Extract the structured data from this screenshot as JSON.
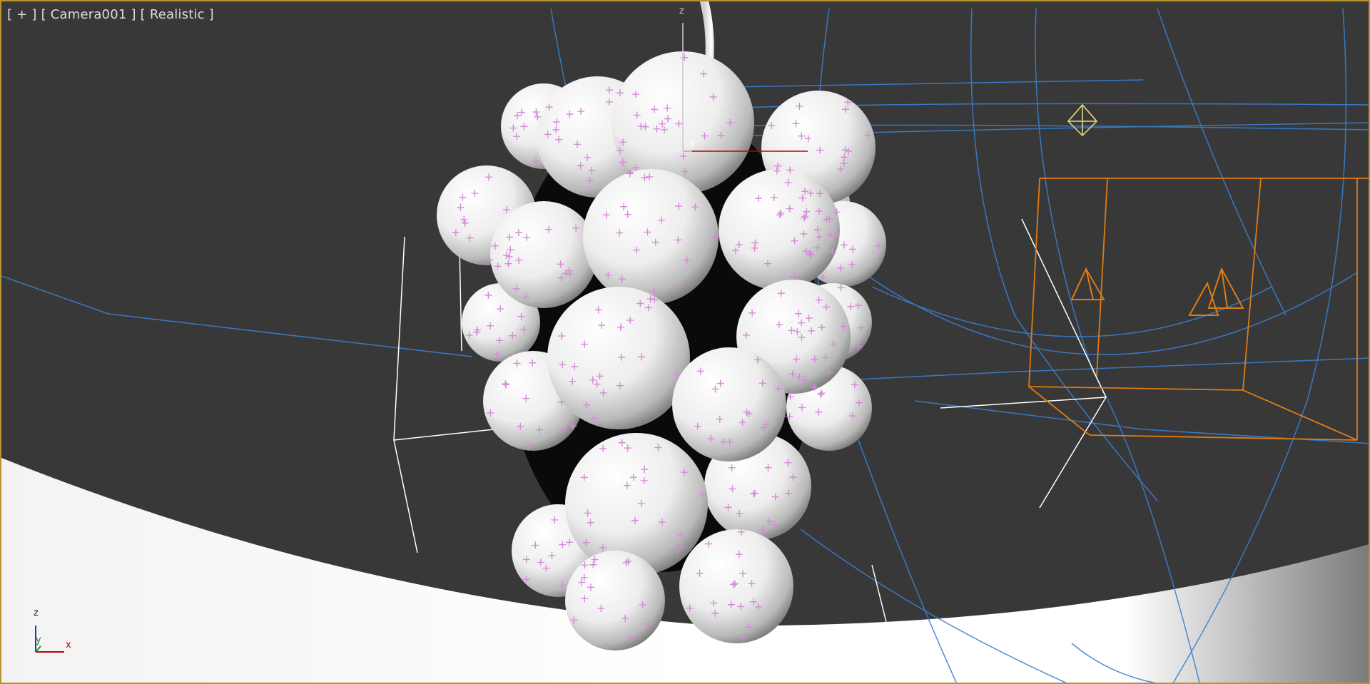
{
  "viewport": {
    "label_menu": "[ + ]",
    "label_camera": "[ Camera001 ]",
    "label_shading": "[ Realistic ]"
  },
  "gizmo": {
    "z": "z",
    "y": "y",
    "x": "x"
  },
  "view_axis": {
    "z": "z",
    "y": "y",
    "x": "x"
  },
  "colors": {
    "viewport_border": "#b8932e",
    "background": "#383838",
    "floor": "#ffffff",
    "grape": "#f2f2f2",
    "particle": "#d58ad8",
    "selection": "#e07b14",
    "wireframe": "#3a7fd0",
    "gizmo_x": "#c00000",
    "gizmo_y": "#2a8a2a",
    "gizmo_z": "#1a3fb0"
  }
}
